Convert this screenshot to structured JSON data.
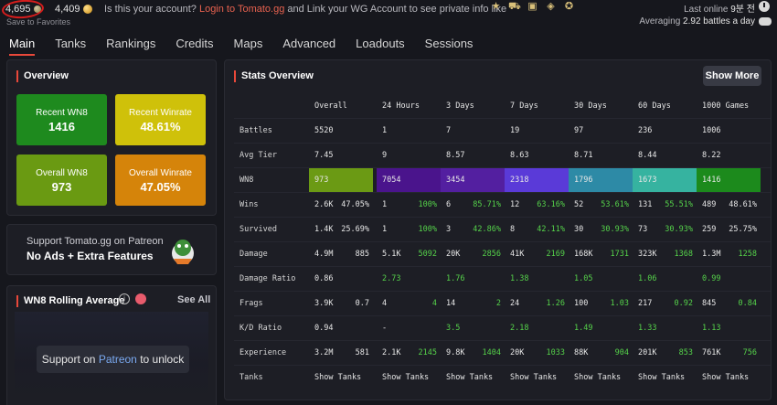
{
  "topbar": {
    "gold": "4,695",
    "credits": "4,409",
    "save_favorites": "Save to Favorites",
    "claim_prefix": "Is this your account?",
    "claim_link": "Login to Tomato.gg",
    "claim_suffix": "and Link your WG Account to see private info like",
    "last_online_label": "Last online",
    "last_online_value": "9분 전",
    "averaging_label": "Averaging",
    "averaging_value": "2.92 battles a day"
  },
  "nav": [
    "Main",
    "Tanks",
    "Rankings",
    "Credits",
    "Maps",
    "Advanced",
    "Loadouts",
    "Sessions"
  ],
  "overview": {
    "title": "Overview",
    "tiles": [
      {
        "label": "Recent WN8",
        "value": "1416",
        "color": "#1e8a1e"
      },
      {
        "label": "Recent Winrate",
        "value": "48.61%",
        "color": "#cfc10a"
      },
      {
        "label": "Overall WN8",
        "value": "973",
        "color": "#6a9a12"
      },
      {
        "label": "Overall Winrate",
        "value": "47.05%",
        "color": "#d5840a"
      }
    ]
  },
  "patreon": {
    "line1": "Support Tomato.gg on Patreon",
    "line2": "No Ads + Extra Features"
  },
  "rolling": {
    "title": "WN8 Rolling Average",
    "see_all": "See All",
    "unlock_prefix": "Support on",
    "unlock_link": "Patreon",
    "unlock_suffix": "to unlock"
  },
  "stats": {
    "title": "Stats Overview",
    "show_more": "Show More",
    "headers": [
      "Overall",
      "24 Hours",
      "3 Days",
      "7 Days",
      "30 Days",
      "60 Days",
      "1000 Games"
    ],
    "wn8_colors": [
      "#6b9a14",
      "#4a148c",
      "#531fa0",
      "#5a3ad8",
      "#2d8aa6",
      "#36b3a0",
      "#1c8a1c"
    ],
    "rows": [
      {
        "label": "Battles",
        "cells": [
          [
            "5520",
            ""
          ],
          [
            "1",
            ""
          ],
          [
            "7",
            ""
          ],
          [
            "19",
            ""
          ],
          [
            "97",
            ""
          ],
          [
            "236",
            ""
          ],
          [
            "1006",
            ""
          ]
        ]
      },
      {
        "label": "Avg Tier",
        "cells": [
          [
            "7.45",
            ""
          ],
          [
            "9",
            ""
          ],
          [
            "8.57",
            ""
          ],
          [
            "8.63",
            ""
          ],
          [
            "8.71",
            ""
          ],
          [
            "8.44",
            ""
          ],
          [
            "8.22",
            ""
          ]
        ]
      },
      {
        "label": "WN8",
        "wn8": true,
        "cells": [
          [
            "973",
            ""
          ],
          [
            "7054",
            ""
          ],
          [
            "3454",
            ""
          ],
          [
            "2318",
            ""
          ],
          [
            "1796",
            ""
          ],
          [
            "1673",
            ""
          ],
          [
            "1416",
            ""
          ]
        ]
      },
      {
        "label": "Wins",
        "cells": [
          [
            "2.6K",
            "47.05%"
          ],
          [
            "1",
            "100%"
          ],
          [
            "6",
            "85.71%"
          ],
          [
            "12",
            "63.16%"
          ],
          [
            "52",
            "53.61%"
          ],
          [
            "131",
            "55.51%"
          ],
          [
            "489",
            "48.61%"
          ]
        ],
        "rw": [
          true,
          true,
          true,
          true,
          true,
          true,
          true
        ],
        "rwhite": [
          true,
          false,
          false,
          false,
          false,
          false,
          true
        ]
      },
      {
        "label": "Survived",
        "cells": [
          [
            "1.4K",
            "25.69%"
          ],
          [
            "1",
            "100%"
          ],
          [
            "3",
            "42.86%"
          ],
          [
            "8",
            "42.11%"
          ],
          [
            "30",
            "30.93%"
          ],
          [
            "73",
            "30.93%"
          ],
          [
            "259",
            "25.75%"
          ]
        ],
        "rwhite": [
          true,
          false,
          false,
          false,
          false,
          false,
          true
        ]
      },
      {
        "label": "Damage",
        "cells": [
          [
            "4.9M",
            "885"
          ],
          [
            "5.1K",
            "5092"
          ],
          [
            "20K",
            "2856"
          ],
          [
            "41K",
            "2169"
          ],
          [
            "168K",
            "1731"
          ],
          [
            "323K",
            "1368"
          ],
          [
            "1.3M",
            "1258"
          ]
        ],
        "rwhite": [
          true,
          false,
          false,
          false,
          false,
          false,
          false
        ]
      },
      {
        "label": "Damage Ratio",
        "cells": [
          [
            "0.86",
            ""
          ],
          [
            "2.73",
            ""
          ],
          [
            "1.76",
            ""
          ],
          [
            "1.38",
            ""
          ],
          [
            "1.05",
            ""
          ],
          [
            "1.06",
            ""
          ],
          [
            "0.99",
            ""
          ]
        ],
        "lgreen": [
          false,
          true,
          true,
          true,
          true,
          true,
          true
        ]
      },
      {
        "label": "Frags",
        "cells": [
          [
            "3.9K",
            "0.7"
          ],
          [
            "4",
            "4"
          ],
          [
            "14",
            "2"
          ],
          [
            "24",
            "1.26"
          ],
          [
            "100",
            "1.03"
          ],
          [
            "217",
            "0.92"
          ],
          [
            "845",
            "0.84"
          ]
        ],
        "rwhite": [
          true,
          false,
          false,
          false,
          false,
          false,
          false
        ]
      },
      {
        "label": "K/D Ratio",
        "cells": [
          [
            "0.94",
            ""
          ],
          [
            "-",
            ""
          ],
          [
            "3.5",
            ""
          ],
          [
            "2.18",
            ""
          ],
          [
            "1.49",
            ""
          ],
          [
            "1.33",
            ""
          ],
          [
            "1.13",
            ""
          ]
        ],
        "lgreen": [
          false,
          false,
          true,
          true,
          true,
          true,
          true
        ]
      },
      {
        "label": "Experience",
        "cells": [
          [
            "3.2M",
            "581"
          ],
          [
            "2.1K",
            "2145"
          ],
          [
            "9.8K",
            "1404"
          ],
          [
            "20K",
            "1033"
          ],
          [
            "88K",
            "904"
          ],
          [
            "201K",
            "853"
          ],
          [
            "761K",
            "756"
          ]
        ],
        "rwhite": [
          true,
          false,
          false,
          false,
          false,
          false,
          false
        ]
      },
      {
        "label": "Tanks",
        "cells": [
          [
            "Show Tanks",
            ""
          ],
          [
            "Show Tanks",
            ""
          ],
          [
            "Show Tanks",
            ""
          ],
          [
            "Show Tanks",
            ""
          ],
          [
            "Show Tanks",
            ""
          ],
          [
            "Show Tanks",
            ""
          ],
          [
            "Show Tanks",
            ""
          ]
        ]
      }
    ]
  }
}
